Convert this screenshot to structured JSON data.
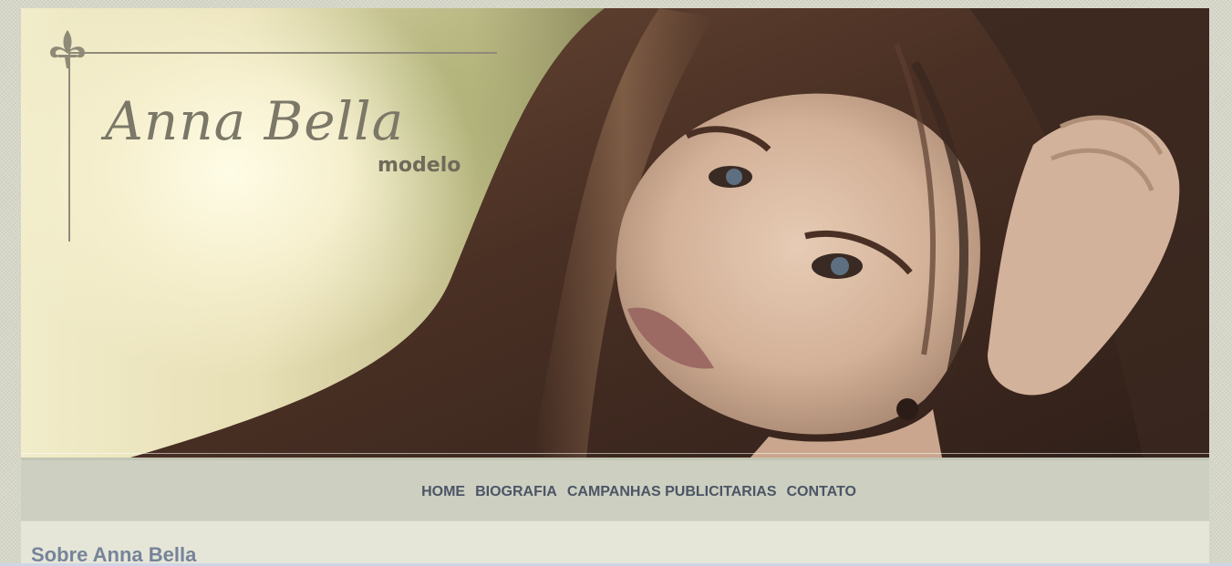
{
  "header": {
    "logo_name": "Anna Bella",
    "logo_subtitle": "modelo",
    "logo_icon": "fleur-de-lis-icon"
  },
  "nav": {
    "items": [
      {
        "label": "HOME"
      },
      {
        "label": "BIOGRAFIA"
      },
      {
        "label": "CAMPANHAS PUBLICITARIAS"
      },
      {
        "label": "CONTATO"
      }
    ]
  },
  "main": {
    "title": "Sobre Anna Bella"
  },
  "colors": {
    "page_bg": "#d6d6c8",
    "nav_bg": "#cdcfc0",
    "nav_text": "#4b5566",
    "content_bg": "#e6e6d8",
    "title_text": "#76849a",
    "logo_text": "#7b7868"
  }
}
